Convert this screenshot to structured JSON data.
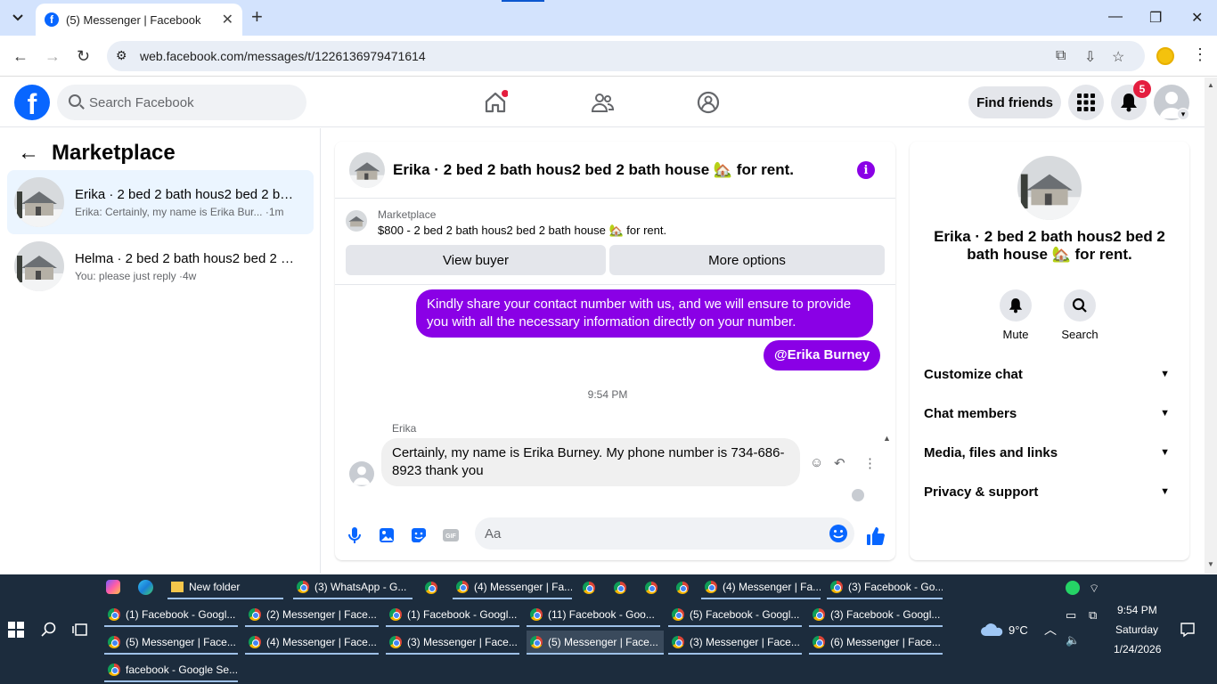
{
  "browser": {
    "tab_title": "(5) Messenger | Facebook",
    "url": "web.facebook.com/messages/t/1226136979471614"
  },
  "fb": {
    "search_placeholder": "Search Facebook",
    "find_friends": "Find friends",
    "notif_count": "5",
    "home_dot_color": "#e41e3f"
  },
  "sidebar": {
    "title": "Marketplace",
    "conversations": [
      {
        "name": "Erika · 2 bed 2 bath hous2 bed 2 bath house",
        "snippet": "Erika: Certainly, my name is Erika Bur... ·1m"
      },
      {
        "name": "Helma · 2 bed 2 bath hous2 bed 2 bath house",
        "snippet": "You: please just reply ·4w"
      }
    ]
  },
  "chat": {
    "title": "Erika · 2 bed 2 bath hous2 bed 2 bath house 🏡 for rent.",
    "marketplace_label": "Marketplace",
    "listing": "$800 - 2 bed 2 bath hous2 bed 2 bath house 🏡 for rent.",
    "view_buyer": "View buyer",
    "more_options": "More options",
    "msg_out_1": "Kindly share your contact number with us, and we will ensure to provide you with all the necessary information directly on your number.",
    "msg_out_2": "@Erika Burney",
    "timestamp": "9:54 PM",
    "sender": "Erika",
    "msg_in": "Certainly, my name is Erika Burney. My phone number is 734-686-8923 thank you",
    "composer_placeholder": "Aa",
    "accent_color": "#8a00e6"
  },
  "details": {
    "title": "Erika · 2 bed 2 bath hous2 bed 2 bath house 🏡 for rent.",
    "mute": "Mute",
    "search": "Search",
    "rows": [
      "Customize chat",
      "Chat members",
      "Media, files and links",
      "Privacy & support"
    ]
  },
  "taskbar": {
    "row1": [
      "New folder",
      "(3) WhatsApp - G...",
      "(4) Messenger | Fa...",
      "(4) Messenger | Fa...",
      "(3) Facebook - Go..."
    ],
    "row2": [
      "(1) Facebook - Googl...",
      "(2) Messenger | Face...",
      "(1) Facebook - Googl...",
      "(11) Facebook - Goo...",
      "(5) Facebook - Googl...",
      "(3) Facebook - Googl..."
    ],
    "row3": [
      "(5) Messenger | Face...",
      "(4) Messenger | Face...",
      "(3) Messenger | Face...",
      "(5) Messenger | Face...",
      "(3) Messenger | Face...",
      "(6) Messenger | Face..."
    ],
    "row4": [
      "facebook - Google Se..."
    ],
    "weather": "9°C",
    "time": "9:54 PM",
    "day": "Saturday",
    "date": "1/24/2026"
  }
}
